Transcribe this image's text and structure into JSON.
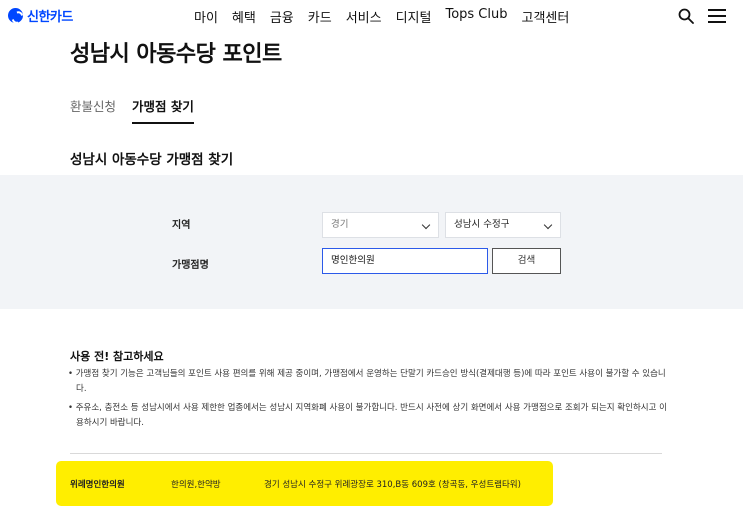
{
  "header": {
    "logo_text": "신한카드",
    "nav": [
      "마이",
      "혜택",
      "금융",
      "카드",
      "서비스",
      "디지털",
      "Tops Club",
      "고객센터"
    ]
  },
  "page": {
    "title": "성남시 아동수당 포인트"
  },
  "tabs": [
    {
      "label": "환불신청",
      "active": false
    },
    {
      "label": "가맹점 찾기",
      "active": true
    }
  ],
  "section_title": "성남시 아동수당 가맹점 찾기",
  "search": {
    "region_label": "지역",
    "region_province": "경기",
    "region_city": "성남시 수정구",
    "merchant_label": "가맹점명",
    "merchant_value": "명인한의원",
    "search_button": "검색"
  },
  "notice": {
    "title": "사용 전! 참고하세요",
    "items": [
      "• 가맹점 찾기 기능은 고객님들의 포인트 사용 편의를 위해 제공 중이며, 가맹점에서 운영하는 단말기 카드승인 방식(결제대행 등)에 따라 포인트 사용이 불가할 수 있습니다.",
      "• 주유소, 충전소 등 성남시에서 사용 제한한 업종에서는 성남시 지역화폐 사용이 불가합니다. 반드시 사전에 상기 화면에서 사용 가맹점으로 조회가 되는지 확인하시고 이용하시기 바랍니다."
    ]
  },
  "results": [
    {
      "name": "위례명인한의원",
      "category": "한의원,한약방",
      "address": "경기 성남시 수정구 위례광장로 310,B동 609호 (창곡동, 우성트램타워)"
    }
  ],
  "colors": {
    "brand": "#0046ff",
    "highlight": "#ffee00",
    "input_focus": "#2c5ae9",
    "panel_bg": "#f2f4f7"
  }
}
